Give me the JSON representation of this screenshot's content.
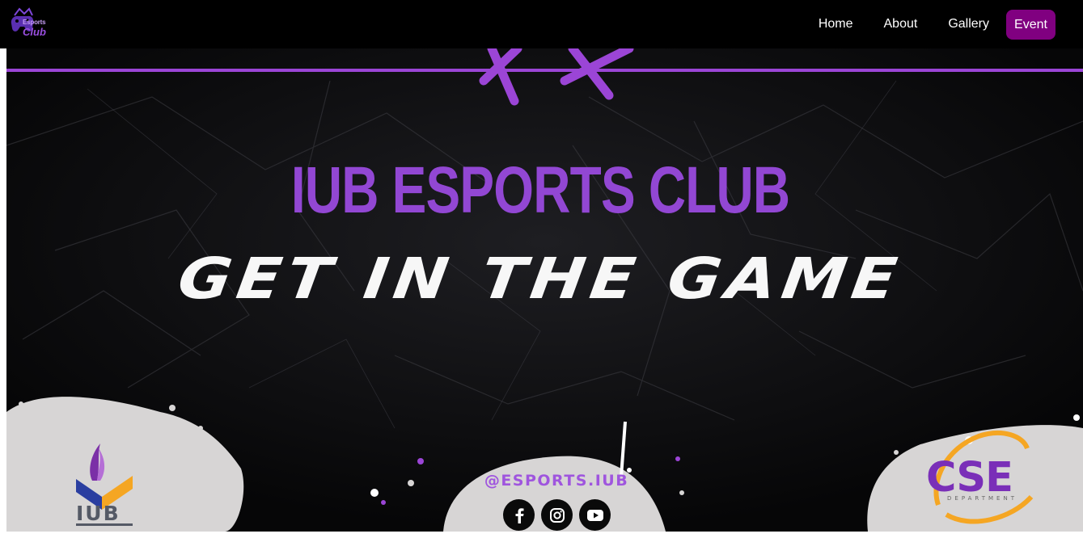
{
  "logo": {
    "name": "esports-club-logo",
    "line1": "Esports",
    "line2": "Club"
  },
  "nav": {
    "items": [
      {
        "label": "Home"
      },
      {
        "label": "About"
      },
      {
        "label": "Gallery"
      },
      {
        "label": "Event"
      }
    ],
    "active_color": "#800080"
  },
  "hero": {
    "title": "IUB ESPORTS CLUB",
    "tagline": "GET IN THE GAME",
    "handle": "@ESPORTS.IUB",
    "social_icons": [
      "facebook-icon",
      "instagram-icon",
      "youtube-icon"
    ],
    "left_logo_text": "IUB",
    "right_logo_text": "CSE",
    "right_logo_sub": "DEPARTMENT",
    "accent_color": "#9247d3"
  }
}
